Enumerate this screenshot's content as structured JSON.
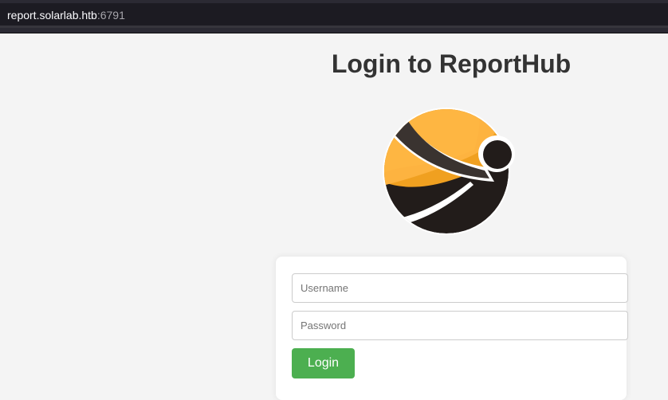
{
  "browser": {
    "url_host": "report.solarlab.htb",
    "url_port": ":6791"
  },
  "page": {
    "title": "Login to ReportHub"
  },
  "logo": {
    "icon": "reporthub-logo-icon",
    "colors": {
      "orange_light": "#fdb340",
      "orange_dark": "#f0a020",
      "band": "#3a3330",
      "base": "#221c1a",
      "outline": "#ffffff"
    }
  },
  "form": {
    "username_placeholder": "Username",
    "username_value": "",
    "password_placeholder": "Password",
    "password_value": "",
    "login_label": "Login"
  },
  "colors": {
    "background": "#f4f4f4",
    "card": "#ffffff",
    "button": "#4caf50",
    "title": "#333333"
  }
}
